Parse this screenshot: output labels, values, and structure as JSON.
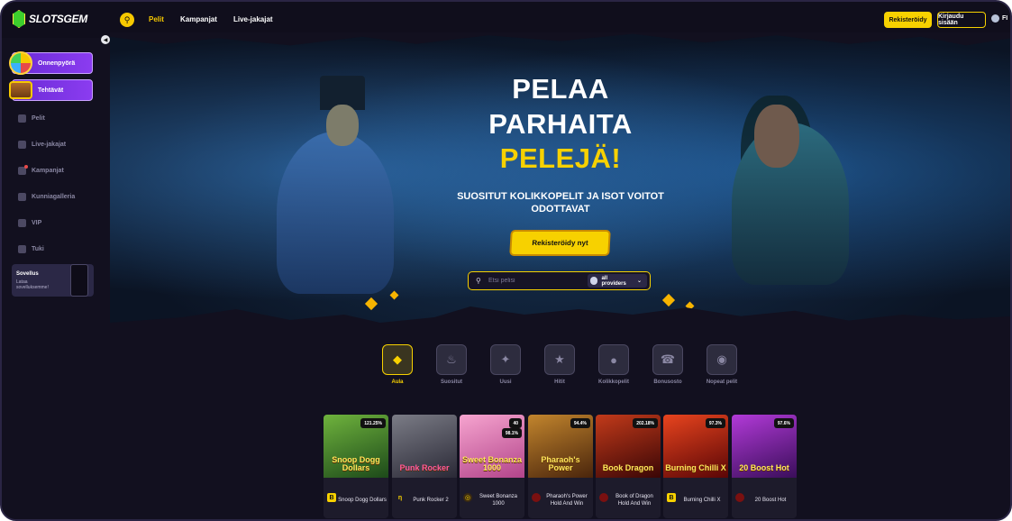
{
  "brand": {
    "name": "SLOTSGEM",
    "accent": "#f7d100",
    "bg": "#12101f"
  },
  "nav": {
    "links": [
      "Pelit",
      "Kampanjat",
      "Live-jakajat"
    ],
    "register": "Rekisteröidy",
    "login": "Kirjaudu sisään",
    "language": "FI"
  },
  "sidebar": {
    "promos": [
      "Onnenpyörä",
      "Tehtävät"
    ],
    "items": [
      "Pelit",
      "Live-jakajat",
      "Kampanjat",
      "Kunniagalleria",
      "VIP",
      "Tuki"
    ],
    "app": {
      "title": "Sovellus",
      "subtitle": "Lataa sovelluksemme!"
    }
  },
  "hero": {
    "title_line1": "PELAA",
    "title_line2": "PARHAITA",
    "title_line3": "PELEJÄ!",
    "subtitle": "SUOSITUT KOLIKKOPELIT JA ISOT VOITOT ODOTTAVAT",
    "cta": "Rekisteröidy nyt",
    "search_placeholder": "Etsi pelisi",
    "providers_label": "all providers"
  },
  "categories": [
    {
      "label": "Aula",
      "icon": "lobby-icon",
      "active": true
    },
    {
      "label": "Suositut",
      "icon": "flame-icon",
      "active": false
    },
    {
      "label": "Uusi",
      "icon": "new-icon",
      "active": false
    },
    {
      "label": "Hitit",
      "icon": "hits-icon",
      "active": false
    },
    {
      "label": "Kolikkopelit",
      "icon": "cherries-icon",
      "active": false
    },
    {
      "label": "Bonusosto",
      "icon": "bonus-buy-icon",
      "active": false
    },
    {
      "label": "Nopeat pelit",
      "icon": "bomb-icon",
      "active": false
    }
  ],
  "games": [
    {
      "name": "Snoop Dogg Dollars",
      "art": "Snoop Dogg Dollars",
      "rtp": "121.25%",
      "provider": "B",
      "color": "#2f6b2a"
    },
    {
      "name": "Punk Rocker 2",
      "art": "Punk Rocker",
      "provider": "η",
      "color": "#3b3a47"
    },
    {
      "name": "Sweet Bonanza 1000",
      "art": "Sweet Bonanza 1000",
      "rtp_top": "40",
      "rtp": "98.1%",
      "provider": "◎",
      "color": "#e46ca8"
    },
    {
      "name": "Pharaoh's Power Hold And Win",
      "art": "Pharaoh's Power",
      "rtp": "94.4%",
      "provider": "●",
      "color": "#6a3a16"
    },
    {
      "name": "Book of Dragon Hold And Win",
      "art": "Book Dragon",
      "rtp": "202.18%",
      "provider": "●",
      "color": "#7a1212"
    },
    {
      "name": "Burning Chilli X",
      "art": "Burning Chilli X",
      "rtp": "97.3%",
      "provider": "B",
      "color": "#b5160f"
    },
    {
      "name": "20 Boost Hot",
      "art": "20 Boost Hot",
      "rtp": "97.6%",
      "provider": "●",
      "color": "#7a2a9a"
    }
  ]
}
